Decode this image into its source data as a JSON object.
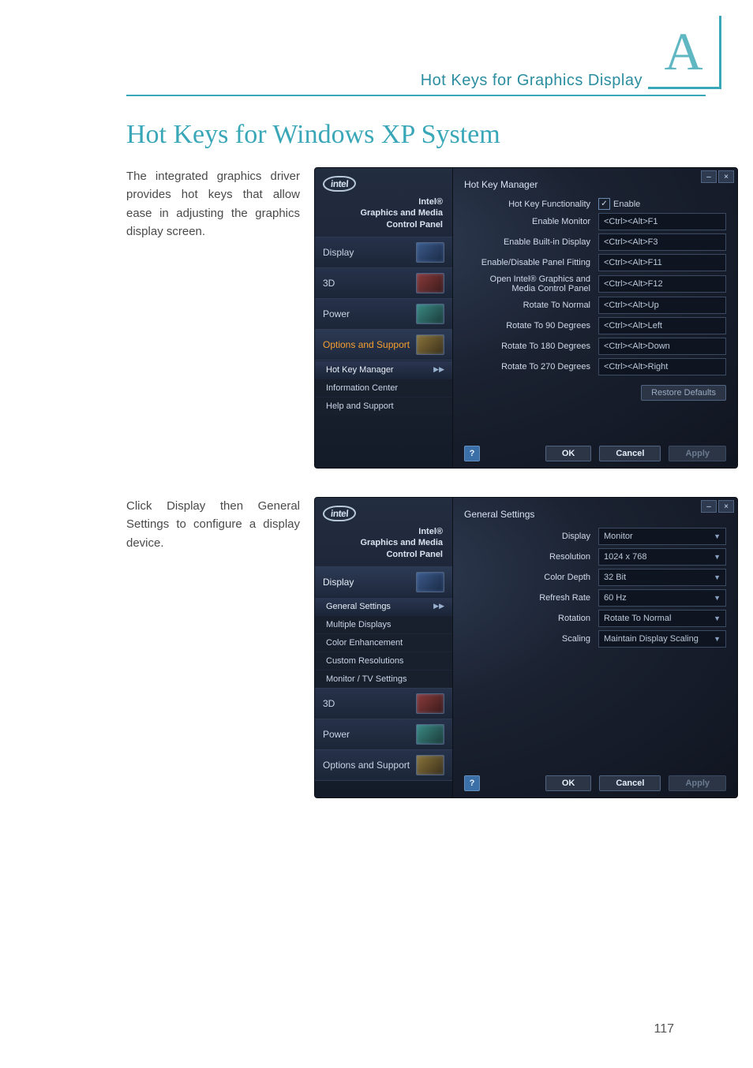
{
  "header": {
    "section_label": "Hot Keys for Graphics Display",
    "appendix_letter": "A"
  },
  "title": "Hot Keys for Windows XP System",
  "para1": "The integrated graphics driver provides hot keys that allow ease in adjusting the graphics display screen.",
  "para2": "Click Display then General Settings to configure a display device.",
  "page_number": "117",
  "common": {
    "cp_title_line1": "Intel®",
    "cp_title_line2": "Graphics and Media",
    "cp_title_line3": "Control Panel",
    "logo_text": "intel",
    "window_minimize": "–",
    "window_close": "×",
    "help_glyph": "?",
    "btn_ok": "OK",
    "btn_cancel": "Cancel",
    "btn_apply": "Apply"
  },
  "shot1": {
    "main_title": "Hot Key Manager",
    "enable_row": {
      "label": "Hot Key Functionality",
      "checkbox_label": "Enable",
      "checked": true
    },
    "restore_defaults": "Restore Defaults",
    "nav": {
      "display": "Display",
      "three_d": "3D",
      "power": "Power",
      "options": "Options and Support"
    },
    "subnav": {
      "hotkey": "Hot Key Manager",
      "info": "Information Center",
      "help": "Help and Support"
    },
    "rows": [
      {
        "label": "Enable Monitor",
        "value": "<Ctrl><Alt>F1"
      },
      {
        "label": "Enable Built-in Display",
        "value": "<Ctrl><Alt>F3"
      },
      {
        "label": "Enable/Disable Panel Fitting",
        "value": "<Ctrl><Alt>F11"
      },
      {
        "label": "Open Intel® Graphics and Media Control Panel",
        "value": "<Ctrl><Alt>F12"
      },
      {
        "label": "Rotate To Normal",
        "value": "<Ctrl><Alt>Up"
      },
      {
        "label": "Rotate To 90 Degrees",
        "value": "<Ctrl><Alt>Left"
      },
      {
        "label": "Rotate To 180 Degrees",
        "value": "<Ctrl><Alt>Down"
      },
      {
        "label": "Rotate To 270 Degrees",
        "value": "<Ctrl><Alt>Right"
      }
    ]
  },
  "shot2": {
    "main_title": "General Settings",
    "nav": {
      "display": "Display",
      "three_d": "3D",
      "power": "Power",
      "options": "Options and Support"
    },
    "subnav": {
      "general": "General Settings",
      "multiple": "Multiple Displays",
      "colorenh": "Color Enhancement",
      "custom": "Custom Resolutions",
      "montv": "Monitor / TV Settings"
    },
    "rows": [
      {
        "label": "Display",
        "value": "Monitor"
      },
      {
        "label": "Resolution",
        "value": "1024 x 768"
      },
      {
        "label": "Color Depth",
        "value": "32 Bit"
      },
      {
        "label": "Refresh Rate",
        "value": "60 Hz"
      },
      {
        "label": "Rotation",
        "value": "Rotate To Normal"
      },
      {
        "label": "Scaling",
        "value": "Maintain Display Scaling"
      }
    ]
  }
}
